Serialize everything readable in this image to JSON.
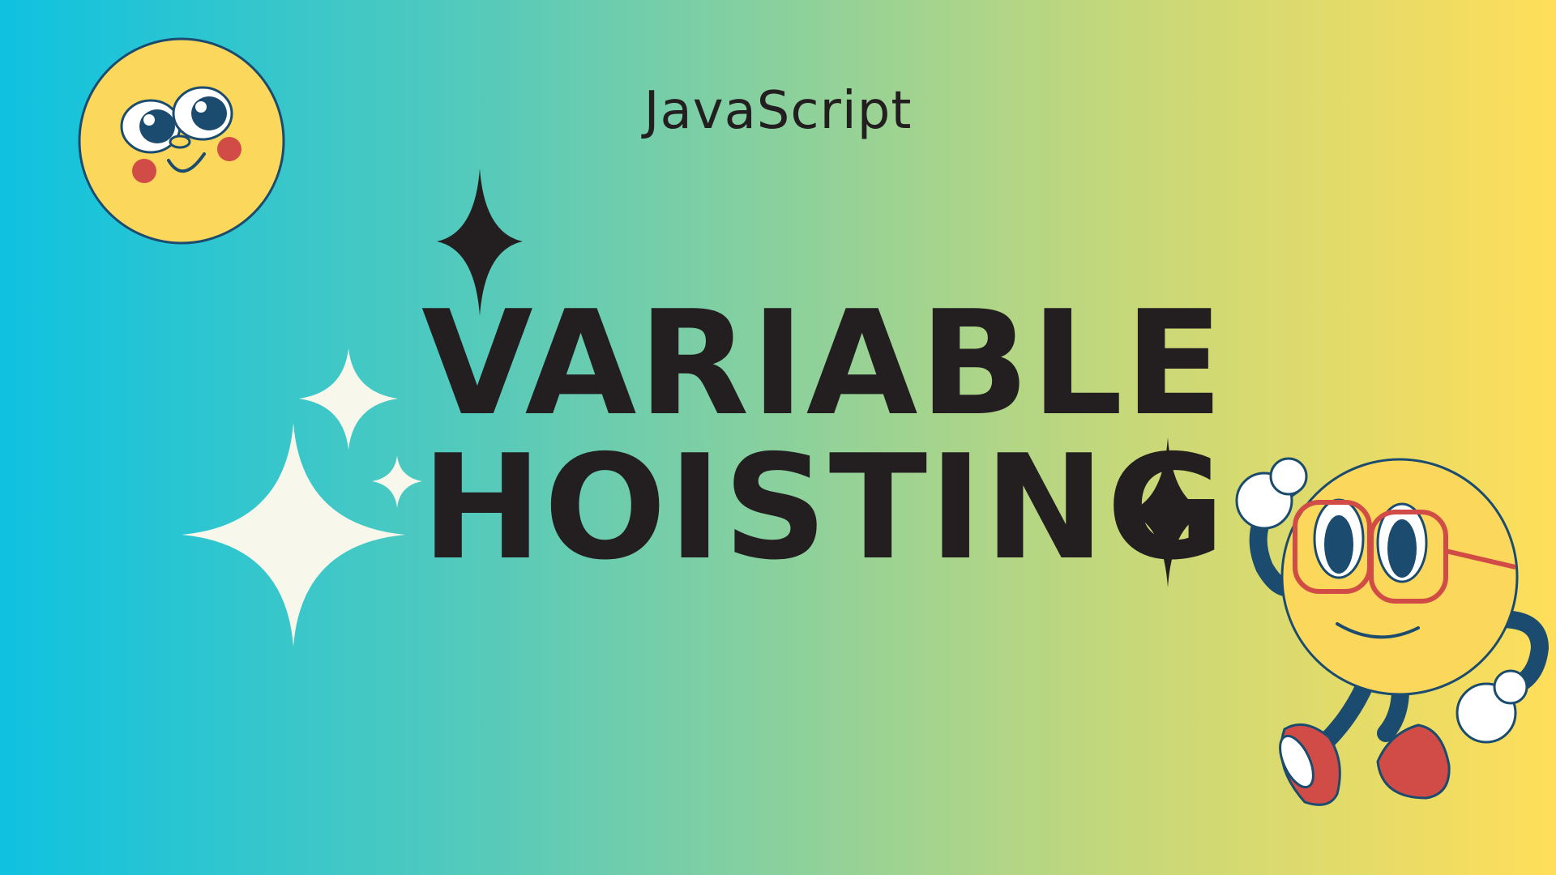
{
  "banner": {
    "subtitle": "JavaScript",
    "title_line1": "VARIABLE",
    "title_line2": "HOISTING",
    "colors": {
      "gradient_left": "#0fc2e0",
      "gradient_right": "#ffde5a",
      "text": "#231f20",
      "sparkle_dark": "#231f20",
      "sparkle_light": "#f7f7ec",
      "mascot_yellow": "#fbd85b",
      "mascot_navy": "#1b4b6e",
      "mascot_red": "#d24c47"
    },
    "icons": [
      "smiley-face-icon",
      "sparkle-icon",
      "mascot-character-icon"
    ]
  }
}
